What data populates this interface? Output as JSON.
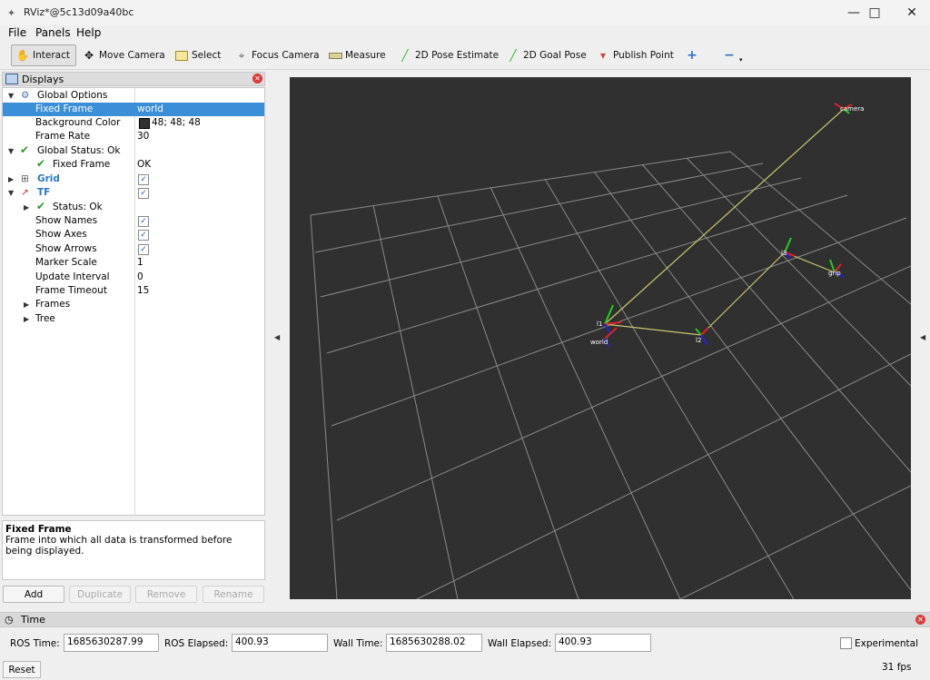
{
  "window": {
    "title": "RViz*@5c13d09a40bc"
  },
  "menubar": {
    "items": [
      "File",
      "Panels",
      "Help"
    ]
  },
  "toolbar": {
    "interact": "Interact",
    "move_camera": "Move Camera",
    "select": "Select",
    "focus_camera": "Focus Camera",
    "measure": "Measure",
    "pose_estimate": "2D Pose Estimate",
    "goal_pose": "2D Goal Pose",
    "publish_point": "Publish Point"
  },
  "displays": {
    "title": "Displays",
    "rows": {
      "global_options": "Global Options",
      "fixed_frame": {
        "name": "Fixed Frame",
        "value": "world"
      },
      "background_color": {
        "name": "Background Color",
        "value": "48; 48; 48",
        "swatch": "#303030"
      },
      "frame_rate": {
        "name": "Frame Rate",
        "value": "30"
      },
      "global_status": "Global Status: Ok",
      "fixed_frame_status": {
        "name": "Fixed Frame",
        "value": "OK"
      },
      "grid": "Grid",
      "tf": "TF",
      "tf_status": "Status: Ok",
      "show_names": "Show Names",
      "show_axes": "Show Axes",
      "show_arrows": "Show Arrows",
      "marker_scale": {
        "name": "Marker Scale",
        "value": "1"
      },
      "update_interval": {
        "name": "Update Interval",
        "value": "0"
      },
      "frame_timeout": {
        "name": "Frame Timeout",
        "value": "15"
      },
      "frames": "Frames",
      "tree": "Tree"
    },
    "description": {
      "title": "Fixed Frame",
      "text": "Frame into which all data is transformed before being displayed."
    },
    "buttons": {
      "add": "Add",
      "duplicate": "Duplicate",
      "remove": "Remove",
      "rename": "Rename"
    }
  },
  "viewport": {
    "background": "#303030",
    "frame_labels": {
      "camera": "camera",
      "l1": "l1",
      "world": "world",
      "l2": "l2",
      "l3": "l3",
      "grip": "grip"
    }
  },
  "time": {
    "title": "Time",
    "ros_time_label": "ROS Time:",
    "ros_time": "1685630287.99",
    "ros_elapsed_label": "ROS Elapsed:",
    "ros_elapsed": "400.93",
    "wall_time_label": "Wall Time:",
    "wall_time": "1685630288.02",
    "wall_elapsed_label": "Wall Elapsed:",
    "wall_elapsed": "400.93",
    "experimental": "Experimental",
    "reset": "Reset",
    "fps": "31 fps"
  }
}
